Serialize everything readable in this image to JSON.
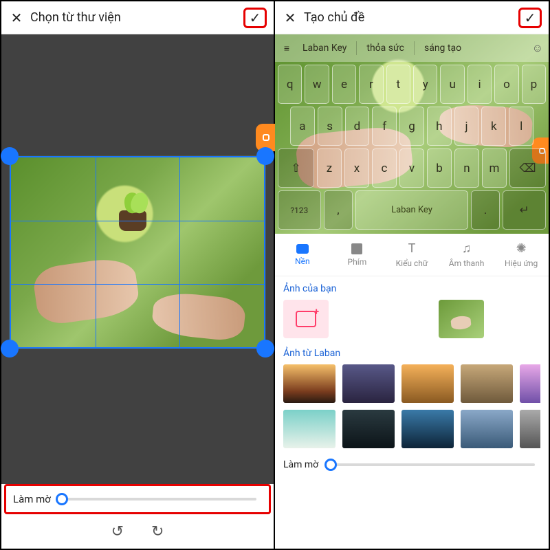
{
  "left": {
    "title": "Chọn từ thư viện",
    "blur_label": "Làm mờ",
    "close_glyph": "✕",
    "confirm_glyph": "✓",
    "rotate_ccw_glyph": "↺",
    "rotate_cw_glyph": "↻"
  },
  "right": {
    "title": "Tạo chủ đề",
    "close_glyph": "✕",
    "confirm_glyph": "✓",
    "suggestions": [
      "Laban Key",
      "thỏa sức",
      "sáng tạo"
    ],
    "menu_glyph": "≡",
    "smile_glyph": "☺",
    "keys_row1": [
      "q",
      "w",
      "e",
      "r",
      "t",
      "y",
      "u",
      "i",
      "o",
      "p"
    ],
    "keys_row2": [
      "a",
      "s",
      "d",
      "f",
      "g",
      "h",
      "j",
      "k",
      "l"
    ],
    "keys_row3_shift": "⇧",
    "keys_row3": [
      "z",
      "x",
      "c",
      "v",
      "b",
      "n",
      "m"
    ],
    "keys_row3_bksp": "⌫",
    "keys_row4_sym": "?123",
    "keys_row4_comma": ",",
    "keys_row4_space": "Laban Key",
    "keys_row4_period": ".",
    "keys_row4_enter": "↵",
    "tabs": [
      {
        "id": "nen",
        "label": "Nền"
      },
      {
        "id": "phim",
        "label": "Phím"
      },
      {
        "id": "kieuchu",
        "label": "Kiểu chữ"
      },
      {
        "id": "amthanh",
        "label": "Âm thanh"
      },
      {
        "id": "hieuung",
        "label": "Hiệu ứng"
      }
    ],
    "tab_icons": {
      "kieuchu": "T",
      "amthanh": "♫",
      "hieuung": "✺"
    },
    "section_your_photos": "Ảnh của bạn",
    "section_laban_photos": "Ảnh từ Laban",
    "blur_label": "Làm mờ"
  }
}
